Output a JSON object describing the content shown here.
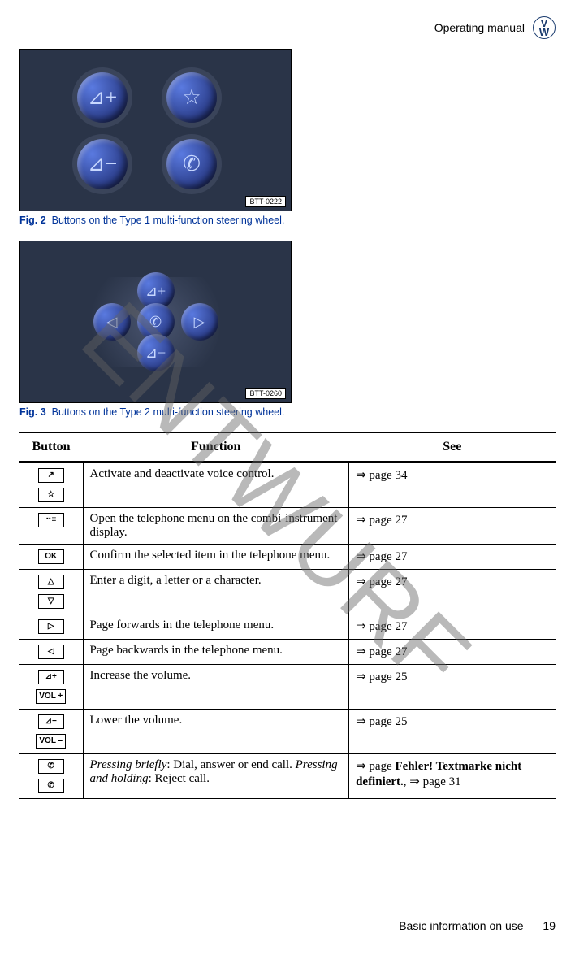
{
  "header": {
    "title": "Operating manual"
  },
  "watermark": "ENTWURF",
  "fig2": {
    "label": "Fig. 2",
    "caption": "Buttons on the Type 1 multi-function steering wheel.",
    "tag": "BTT-0222"
  },
  "fig3": {
    "label": "Fig. 3",
    "caption": "Buttons on the Type 2 multi-function steering wheel.",
    "tag": "BTT-0260"
  },
  "table": {
    "headers": {
      "button": "Button",
      "function": "Function",
      "see": "See"
    },
    "rows": [
      {
        "icons": [
          "↗",
          "☆"
        ],
        "function_plain": "Activate and deactivate voice control.",
        "see_plain": "⇒ page 34"
      },
      {
        "icons": [
          "⠒≡"
        ],
        "function_plain": "Open the telephone menu on the combi-instrument display.",
        "see_plain": "⇒ page 27"
      },
      {
        "icons": [
          "OK"
        ],
        "function_plain": "Confirm the selected item in the telephone menu.",
        "see_plain": "⇒ page 27"
      },
      {
        "icons": [
          "△",
          "▽"
        ],
        "function_plain": "Enter a digit, a letter or a character.",
        "see_plain": "⇒ page 27"
      },
      {
        "icons": [
          "▷"
        ],
        "function_plain": "Page forwards in the telephone menu.",
        "see_plain": "⇒ page 27"
      },
      {
        "icons": [
          "◁"
        ],
        "function_plain": "Page backwards in the telephone menu.",
        "see_plain": "⇒ page 27"
      },
      {
        "icons": [
          "⊿+",
          "VOL +"
        ],
        "function_plain": "Increase the volume.",
        "see_plain": "⇒ page 25"
      },
      {
        "icons": [
          "⊿−",
          "VOL –"
        ],
        "function_plain": "Lower the volume.",
        "see_plain": "⇒ page 25"
      },
      {
        "icons": [
          "✆",
          "✆"
        ],
        "function_html": "<span class='italic'>Pressing briefly</span>: Dial, answer or end call. <span class='italic'>Pressing and holding</span>: Reject call.",
        "see_html": "⇒ page <span class='bold'>Fehler! Textmarke nicht definiert.</span>, ⇒ page 31"
      }
    ]
  },
  "footer": {
    "section": "Basic information on use",
    "page": "19"
  }
}
